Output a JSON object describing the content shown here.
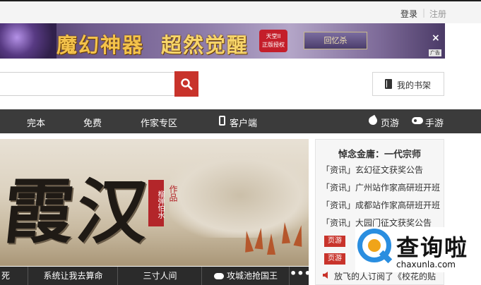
{
  "topbar": {
    "login": "登录",
    "separator": "|",
    "register": "注册"
  },
  "banner": {
    "title1": "魔幻神器",
    "title2": "超然觉醒",
    "badge_line1": "天堂II",
    "badge_line2": "正版授权",
    "button": "回忆杀",
    "close": "×",
    "ad_tag": "广告"
  },
  "search": {
    "placeholder": ""
  },
  "shelf": {
    "label": "我的书架"
  },
  "nav": {
    "items": [
      "完本",
      "免费",
      "作家专区",
      "客户端"
    ],
    "page_game": "页游",
    "mobile_game": "手游"
  },
  "hero": {
    "char1": "霞",
    "char2": "汉",
    "seal": "榴弹怕水",
    "sub": "作品"
  },
  "tabs": [
    "死",
    "系统让我去算命",
    "三寸人间",
    "攻城池抢国王"
  ],
  "tabs_more": "•••",
  "rpanel": {
    "title": "悼念金庸：一代宗师",
    "news": [
      "「资讯」玄幻征文获奖公告",
      "「资讯」广州站作家高研班开班",
      "「资讯」成都站作家高研班开班",
      "「资讯」大园门征文获奖公告"
    ],
    "tags": [
      {
        "tag": "页游",
        "text": ""
      },
      {
        "tag": "页游",
        "text": ""
      }
    ],
    "last": "放飞的人订阅了《校花的贴"
  },
  "watermark": {
    "cn": "查询啦",
    "en": "chaxunla.com"
  },
  "colors": {
    "accent": "#c8332b",
    "nav_bg": "#3b3b3b",
    "watermark_blue": "#2a8ee0",
    "watermark_orange": "#f0a419"
  }
}
